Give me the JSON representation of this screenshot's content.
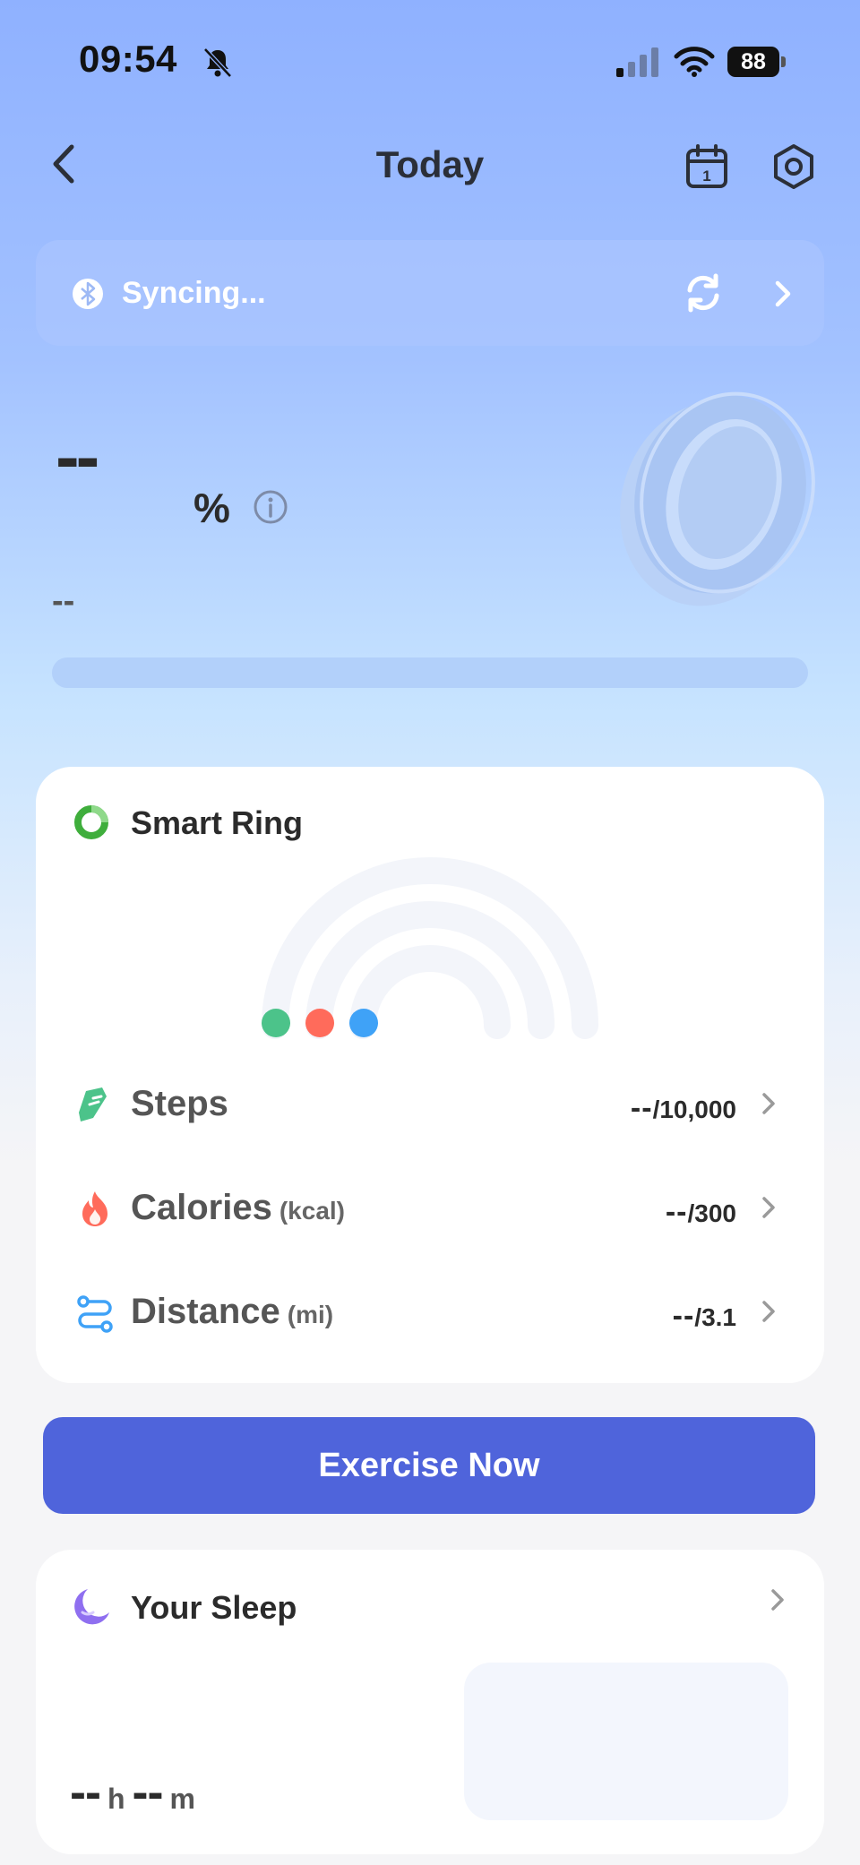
{
  "status_bar": {
    "time": "09:54",
    "battery": "88"
  },
  "header": {
    "title": "Today"
  },
  "sync": {
    "text": "Syncing..."
  },
  "hero": {
    "value": "--",
    "unit": "%",
    "subtitle": "--",
    "progress": 0
  },
  "smart_ring": {
    "title": "Smart Ring",
    "metrics": [
      {
        "label": "Steps",
        "unit": "",
        "value": "--",
        "goal": "/10,000",
        "color": "#4cc38a"
      },
      {
        "label": "Calories",
        "unit": "(kcal)",
        "value": "--",
        "goal": "/300",
        "color": "#ff6b5b"
      },
      {
        "label": "Distance",
        "unit": "(mi)",
        "value": "--",
        "goal": "/3.1",
        "color": "#3fa2f7"
      }
    ]
  },
  "exercise": {
    "label": "Exercise Now",
    "color": "#4f64db"
  },
  "sleep": {
    "title": "Your Sleep",
    "hours": "--",
    "hours_unit": "h",
    "minutes": "--",
    "minutes_unit": "m"
  }
}
